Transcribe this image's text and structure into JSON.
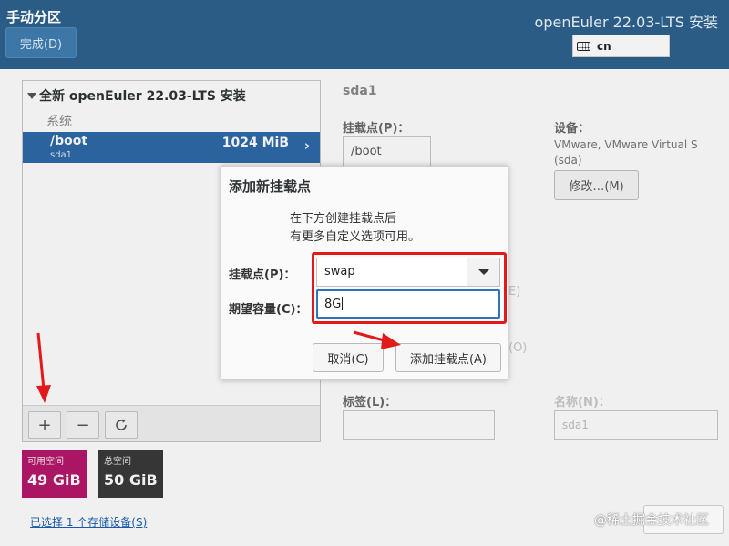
{
  "header": {
    "title": "手动分区",
    "done_label": "完成(D)",
    "product": "openEuler 22.03-LTS 安装",
    "keyboard_layout": "cn"
  },
  "left_panel": {
    "install_title": "全新 openEuler 22.03-LTS 安装",
    "group_label": "系统",
    "selected_row": {
      "mount_point": "/boot",
      "device": "sda1",
      "size": "1024 MiB"
    }
  },
  "space": {
    "available_label": "可用空间",
    "available_value": "49 GiB",
    "total_label": "总空间",
    "total_value": "50 GiB"
  },
  "storage_link": "已选择 1 个存储设备(S)",
  "right_panel": {
    "partition_title": "sda1",
    "mount_point_label": "挂载点(P)：",
    "mount_point_value": "/boot",
    "device_label": "设备：",
    "device_value_line1": "VMware, VMware Virtual S",
    "device_value_line2": "(sda)",
    "modify_button": "修改…(M)",
    "partial_label_e": "E)",
    "partial_label_o": "(O)",
    "tag_label": "标签(L)：",
    "name_label": "名称(N)：",
    "name_value": "sda1"
  },
  "dialog": {
    "title": "添加新挂载点",
    "desc_line1": "在下方创建挂载点后",
    "desc_line2": "有更多自定义选项可用。",
    "mount_point_label": "挂载点(P)：",
    "mount_point_value": "swap",
    "capacity_label": "期望容量(C)：",
    "capacity_value": "8G",
    "cancel_button": "取消(C)",
    "add_button": "添加挂载点(A)"
  },
  "watermark": "@稀土掘金技术社区",
  "colors": {
    "header_bg": "#2a5c86",
    "selection": "#2e6aa8",
    "available_tile": "#b5186a",
    "total_tile": "#3a3a3a",
    "annotation_red": "#e31a1a"
  }
}
